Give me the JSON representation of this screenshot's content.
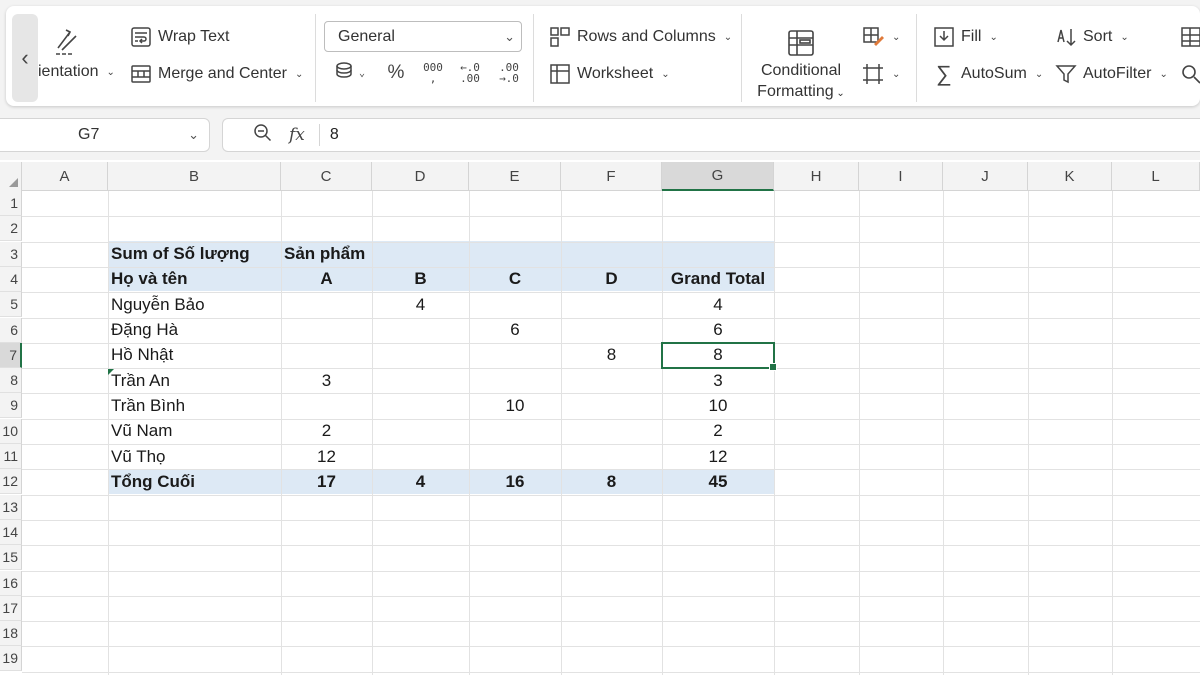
{
  "ribbon": {
    "orientation_label": "ientation",
    "wrap_text_label": "Wrap Text",
    "merge_center_label": "Merge and Center",
    "number_format_value": "General",
    "rows_columns_label": "Rows and Columns",
    "worksheet_label": "Worksheet",
    "conditional_line1": "Conditional",
    "conditional_line2": "Formatting",
    "fill_label": "Fill",
    "sort_label": "Sort",
    "autosum_label": "AutoSum",
    "autofilter_label": "AutoFilter",
    "percent_symbol": "%",
    "thousands_symbol": "000"
  },
  "formula_bar": {
    "cell_ref": "G7",
    "fx_label": "fx",
    "value": "8"
  },
  "columns": [
    "A",
    "B",
    "C",
    "D",
    "E",
    "F",
    "G",
    "H",
    "I",
    "J",
    "K",
    "L"
  ],
  "rows": [
    "1",
    "2",
    "3",
    "4",
    "5",
    "6",
    "7",
    "8",
    "9",
    "10",
    "11",
    "12",
    "13",
    "14",
    "15",
    "16",
    "17",
    "18",
    "19"
  ],
  "active_cell": {
    "column": "G",
    "row": "7"
  },
  "pivot": {
    "value_header": "Sum of Số lượng",
    "column_field": "Sản phẩm",
    "row_field": "Họ và tên",
    "products": [
      "A",
      "B",
      "C",
      "D"
    ],
    "grand_total_label": "Grand Total",
    "rows": [
      {
        "name": "Nguyễn Bảo",
        "A": "",
        "B": "4",
        "C": "",
        "D": "",
        "total": "4"
      },
      {
        "name": "Đặng Hà",
        "A": "",
        "B": "",
        "C": "6",
        "D": "",
        "total": "6"
      },
      {
        "name": "Hồ Nhật",
        "A": "",
        "B": "",
        "C": "",
        "D": "8",
        "total": "8"
      },
      {
        "name": "Trần An",
        "A": "3",
        "B": "",
        "C": "",
        "D": "",
        "total": "3"
      },
      {
        "name": "Trần Bình",
        "A": "",
        "B": "",
        "C": "10",
        "D": "",
        "total": "10"
      },
      {
        "name": "Vũ Nam",
        "A": "2",
        "B": "",
        "C": "",
        "D": "",
        "total": "2"
      },
      {
        "name": "Vũ Thọ",
        "A": "12",
        "B": "",
        "C": "",
        "D": "",
        "total": "12"
      }
    ],
    "totals": {
      "label": "Tổng Cuối",
      "A": "17",
      "B": "4",
      "C": "16",
      "D": "8",
      "total": "45"
    }
  },
  "colors": {
    "accent": "#217346",
    "pivot_band": "#dde9f5"
  }
}
